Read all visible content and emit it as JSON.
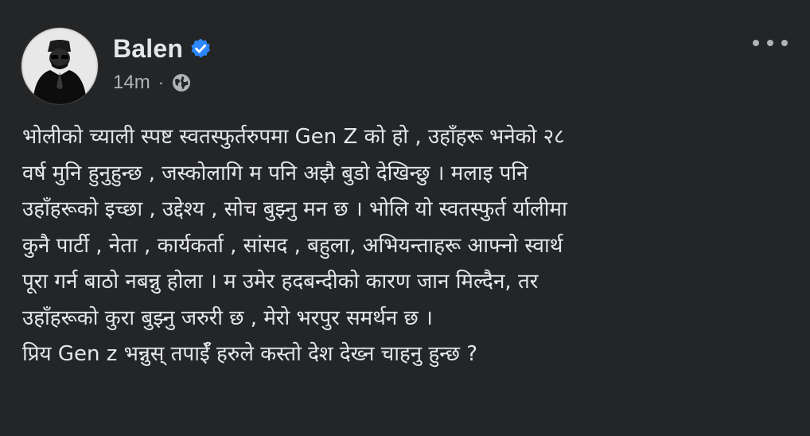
{
  "post": {
    "author": {
      "name": "Balen",
      "verified_icon": "verified-badge-icon",
      "verified_color": "#2d88ff",
      "avatar_icon": "profile-photo-avatar"
    },
    "meta": {
      "time": "14m",
      "separator": "·",
      "audience_icon": "globe-public-icon"
    },
    "more_icon": "more-options-icon",
    "text_lines": [
      "भोलीको च्याली स्पष्ट  स्वतस्फुर्तरुपमा Gen Z को हो , उहाँहरू भनेको २८",
      "वर्ष मुनि हुनुहुन्छ , जस्कोलागि म पनि अझै बुडो देखिन्छु । मलाइ पनि",
      "उहाँहरूको इच्छा , उद्देश्य , सोच बुझ्नु मन छ । भोलि यो स्वतस्फुर्त र्यालीमा",
      "कुनै पार्टी , नेता , कार्यकर्ता , सांसद , बहुला, अभियन्ताहरू आफ्नो स्वार्थ",
      "पूरा गर्न बाठो नबन्नु होला । म उमेर हदबन्दीको कारण जान मिल्दैन, तर",
      "उहाँहरूको कुरा बुझ्नु जरुरी छ , मेरो भरपुर समर्थन छ ।",
      "प्रिय Gen z भन्नुस् तपाईँ हरुले कस्तो देश देख्न चाहनु हुन्छ ?"
    ]
  },
  "colors": {
    "background": "#242526",
    "primary_text": "#e4e6eb",
    "secondary_text": "#b0b3b8",
    "accent": "#2d88ff"
  }
}
